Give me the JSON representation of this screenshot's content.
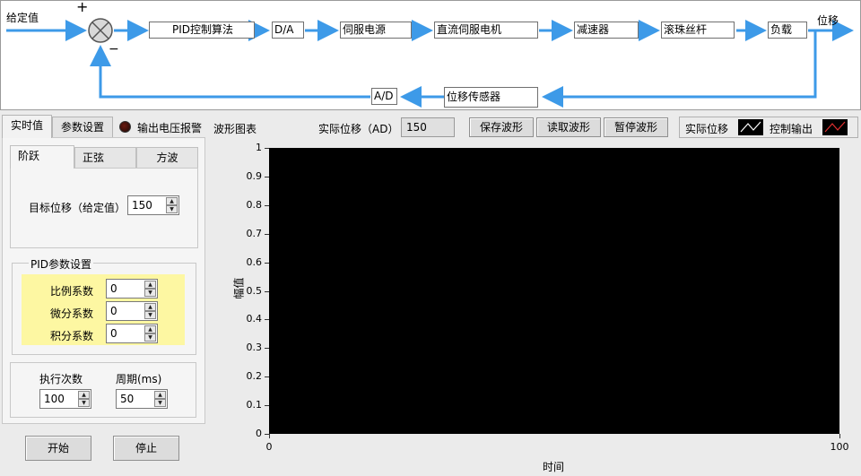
{
  "diagram": {
    "setpoint_label": "给定值",
    "plus_sign": "+",
    "minus_sign": "−",
    "output_label": "位移",
    "blocks": {
      "pid": "PID控制算法",
      "da": "D/A",
      "servo_power": "伺服电源",
      "dc_motor": "直流伺服电机",
      "reducer": "减速器",
      "ball_screw": "滚珠丝杆",
      "load": "负载",
      "sensor": "位移传感器",
      "ad": "A/D"
    }
  },
  "tabs": {
    "realtime": "实时值",
    "params": "参数设置"
  },
  "alarm_label": "输出电压报警",
  "waveform_subtabs": [
    "阶跃",
    "正弦",
    "方波"
  ],
  "target_position": {
    "label": "目标位移（给定值）",
    "value": "150"
  },
  "pid_group": {
    "title": "PID参数设置",
    "kp": {
      "label": "比例系数",
      "value": "0"
    },
    "kd": {
      "label": "微分系数",
      "value": "0"
    },
    "ki": {
      "label": "积分系数",
      "value": "0"
    }
  },
  "exec": {
    "count_label": "执行次数",
    "count_value": "100",
    "period_label": "周期(ms)",
    "period_value": "50"
  },
  "controls": {
    "start": "开始",
    "stop": "停止"
  },
  "chart_header": {
    "title": "波形图表",
    "actual_label": "实际位移（AD）",
    "actual_value": "150",
    "save": "保存波形",
    "read": "读取波形",
    "pause": "暂停波形",
    "legend_actual": "实际位移",
    "legend_control": "控制输出"
  },
  "colors": {
    "arrow": "#3d9ae8",
    "plot_bg": "#000000",
    "pid_group_bg": "#fdf7a2",
    "legend_control": "#e03030",
    "legend_actual": "#ffffff"
  },
  "chart_data": {
    "type": "line",
    "xlabel": "时间",
    "ylabel": "幅值",
    "xlim": [
      0,
      100
    ],
    "ylim": [
      0,
      1
    ],
    "x_ticks": [
      "0",
      "100"
    ],
    "y_ticks": [
      "0",
      "0.1",
      "0.2",
      "0.3",
      "0.4",
      "0.5",
      "0.6",
      "0.7",
      "0.8",
      "0.9",
      "1"
    ],
    "series": [
      {
        "name": "实际位移",
        "values": []
      },
      {
        "name": "控制输出",
        "values": []
      }
    ]
  }
}
